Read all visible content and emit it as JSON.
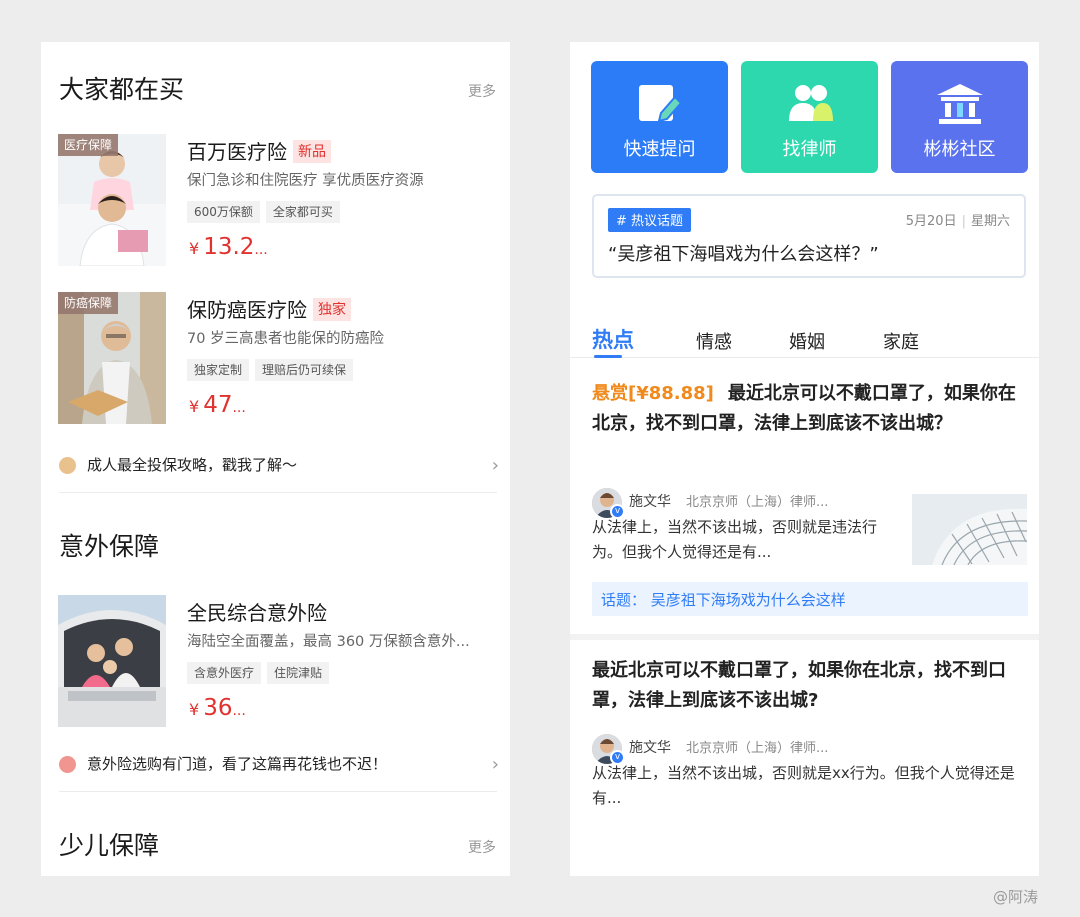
{
  "left": {
    "section1": {
      "title": "大家都在买",
      "more": "更多"
    },
    "products": [
      {
        "tag": "医疗保障",
        "name": "百万医疗险",
        "badge": "新品",
        "desc": "保门急诊和住院医疗  享优质医疗资源",
        "chips": [
          "600万保额",
          "全家都可买"
        ],
        "price_symbol": "¥",
        "price": "13.2",
        "price_suffix": "..."
      },
      {
        "tag": "防癌保障",
        "name": "保防癌医疗险",
        "badge": "独家",
        "desc": "70 岁三高患者也能保的防癌险",
        "chips": [
          "独家定制",
          "理赔后仍可续保"
        ],
        "price_symbol": "¥",
        "price": "47",
        "price_suffix": "..."
      },
      {
        "tag": "",
        "name": "全民综合意外险",
        "badge": "",
        "desc": "海陆空全面覆盖，最高 360 万保额含意外...",
        "chips": [
          "含意外医疗",
          "住院津贴"
        ],
        "price_symbol": "¥",
        "price": "36",
        "price_suffix": "..."
      }
    ],
    "tip1": {
      "text": "成人最全投保攻略，戳我了解～",
      "arrow": "›"
    },
    "section2": {
      "title": "意外保障"
    },
    "tip2": {
      "text": "意外险选购有门道，看了这篇再花钱也不迟！",
      "arrow": "›"
    },
    "section3": {
      "title": "少儿保障",
      "more": "更多"
    }
  },
  "right": {
    "actions": [
      {
        "label": "快速提问",
        "color": "#2d7cf7"
      },
      {
        "label": "找律师",
        "color": "#2ed8ae"
      },
      {
        "label": "彬彬社区",
        "color": "#5a72ee"
      }
    ],
    "topic": {
      "tag": "# 热议话题",
      "date": "5月20日",
      "weekday": "星期六",
      "quote": "“吴彦祖下海唱戏为什么会这样？”"
    },
    "tabs": [
      "热点",
      "情感",
      "婚姻",
      "家庭"
    ],
    "post1": {
      "bounty": "悬赏[¥88.88]",
      "title": "最近北京可以不戴口罩了，如果你在北京，找不到口罩，法律上到底该不该出城？",
      "author": "施文华",
      "author_title": "北京京师（上海）律师...",
      "answer": "从法律上，当然不该出城，否则就是违法行为。但我个人觉得还是有...",
      "topic_link": "话题：  吴彦祖下海场戏为什么会这样"
    },
    "post2": {
      "title": "最近北京可以不戴口罩了，如果你在北京，找不到口罩，法律上到底该不该出城?",
      "author": "施文华",
      "author_title": "北京京师（上海）律师...",
      "answer": "从法律上，当然不该出城，否则就是xx行为。但我个人觉得还是有..."
    }
  },
  "watermark": "@阿涛",
  "colors": {
    "accent": "#2f7cf6",
    "price": "#e0322f",
    "bounty": "#f08a1c"
  }
}
